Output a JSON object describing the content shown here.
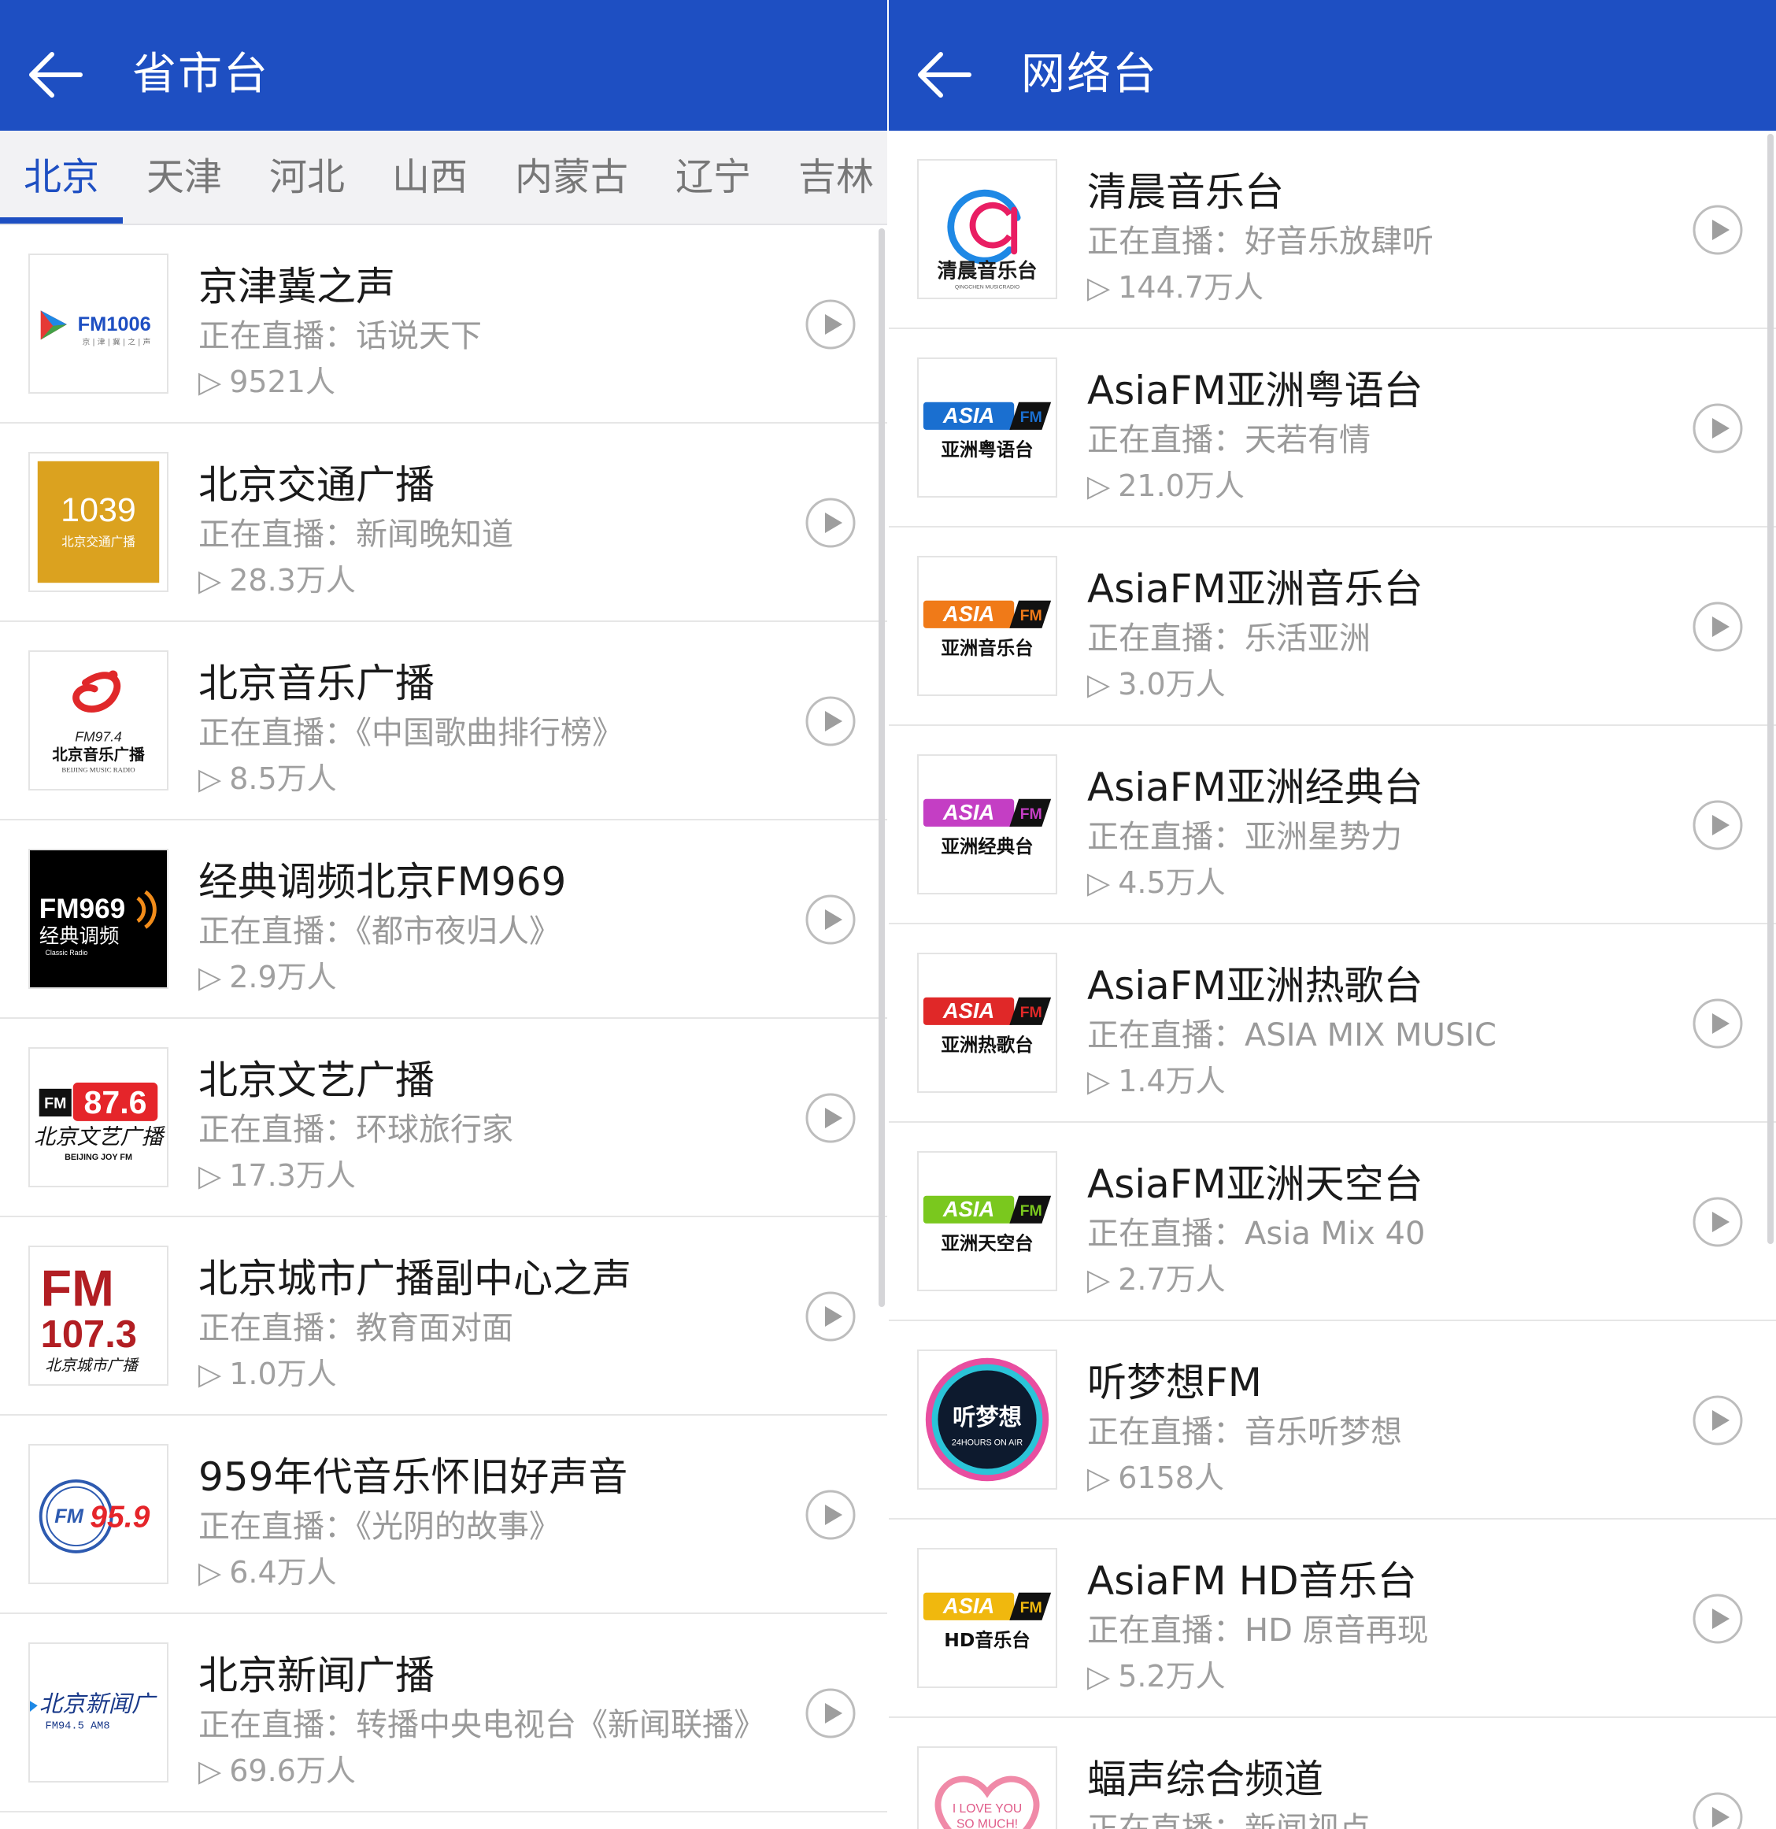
{
  "colors": {
    "accent": "#1e4fc2",
    "text": "#1a1a1a",
    "muted": "#9a9a9a"
  },
  "left": {
    "title": "省市台",
    "tabs": [
      "北京",
      "天津",
      "河北",
      "山西",
      "内蒙古",
      "辽宁",
      "吉林"
    ],
    "active_tab": "北京",
    "stations": [
      {
        "name": "京津冀之声",
        "now_playing": "正在直播：话说天下",
        "listeners": "9521人",
        "logo": "fm1006-logo"
      },
      {
        "name": "北京交通广播",
        "now_playing": "正在直播：新闻晚知道",
        "listeners": "28.3万人",
        "logo": "1039-logo",
        "logo_text": "1039",
        "logo_sub": "北京交通广播"
      },
      {
        "name": "北京音乐广播",
        "now_playing": "正在直播：《中国歌曲排行榜》",
        "listeners": "8.5万人",
        "logo": "fm974-logo",
        "logo_text": "FM97.4",
        "logo_sub": "北京音乐广播",
        "logo_sub2": "BEIJING MUSIC RADIO"
      },
      {
        "name": "经典调频北京FM969",
        "now_playing": "正在直播：《都市夜归人》",
        "listeners": "2.9万人",
        "logo": "fm969-logo",
        "logo_text": "FM969",
        "logo_sub": "经典调频",
        "logo_sub2": "Classic Radio"
      },
      {
        "name": "北京文艺广播",
        "now_playing": "正在直播：环球旅行家",
        "listeners": "17.3万人",
        "logo": "fm876-logo",
        "logo_text": "87.6",
        "logo_sub": "北京文艺广播",
        "logo_sub2": "BEIJING JOY FM"
      },
      {
        "name": "北京城市广播副中心之声",
        "now_playing": "正在直播：教育面对面",
        "listeners": "1.0万人",
        "logo": "fm1073-logo",
        "logo_text": "FM",
        "logo_sub": "107.3",
        "logo_sub2": "北京城市广播"
      },
      {
        "name": "959年代音乐怀旧好声音",
        "now_playing": "正在直播：《光阴的故事》",
        "listeners": "6.4万人",
        "logo": "fm959-logo",
        "logo_text": "95.9"
      },
      {
        "name": "北京新闻广播",
        "now_playing": "正在直播：转播中央电视台《新闻联播》",
        "listeners": "69.6万人",
        "logo": "bj-news-logo",
        "logo_text": "北京新闻广",
        "logo_sub": "FM94.5   AM8"
      }
    ]
  },
  "right": {
    "title": "网络台",
    "stations": [
      {
        "name": "清晨音乐台",
        "now_playing": "正在直播：好音乐放肆听",
        "listeners": "144.7万人",
        "logo": "qingchen-logo",
        "logo_text": "清晨音乐台",
        "logo_sub": "QINGCHEN MUSICRADIO"
      },
      {
        "name": "AsiaFM亚洲粤语台",
        "now_playing": "正在直播：天若有情",
        "listeners": "21.0万人",
        "logo": "asiafm-logo",
        "logo_color": "#1a6fd0",
        "logo_text": "亚洲粤语台"
      },
      {
        "name": "AsiaFM亚洲音乐台",
        "now_playing": "正在直播：乐活亚洲",
        "listeners": "3.0万人",
        "logo": "asiafm-logo",
        "logo_color": "#f07a18",
        "logo_text": "亚洲音乐台"
      },
      {
        "name": "AsiaFM亚洲经典台",
        "now_playing": "正在直播：亚洲星势力",
        "listeners": "4.5万人",
        "logo": "asiafm-logo",
        "logo_color": "#c43ec4",
        "logo_text": "亚洲经典台"
      },
      {
        "name": "AsiaFM亚洲热歌台",
        "now_playing": "正在直播：ASIA MIX MUSIC",
        "listeners": "1.4万人",
        "logo": "asiafm-logo",
        "logo_color": "#e02828",
        "logo_text": "亚洲热歌台"
      },
      {
        "name": "AsiaFM亚洲天空台",
        "now_playing": "正在直播：Asia Mix 40",
        "listeners": "2.7万人",
        "logo": "asiafm-logo",
        "logo_color": "#7ac81e",
        "logo_text": "亚洲天空台"
      },
      {
        "name": "听梦想FM",
        "now_playing": "正在直播：音乐听梦想",
        "listeners": "6158人",
        "logo": "tingmengxiang-logo",
        "logo_text": "听梦想",
        "logo_sub": "24HOURS ON AIR"
      },
      {
        "name": "AsiaFM HD音乐台",
        "now_playing": "正在直播：HD 原音再现",
        "listeners": "5.2万人",
        "logo": "asiafm-logo",
        "logo_color": "#f0b80e",
        "logo_text": "HD音乐台"
      },
      {
        "name": "蝠声综合频道",
        "now_playing": "正在直播：新闻视点",
        "listeners": "",
        "logo": "i-love-you-logo",
        "logo_text": "I LOVE YOU",
        "logo_sub": "SO MUCH!"
      }
    ]
  },
  "icons": {
    "back": "arrow-left-icon",
    "play": "play-circle-icon",
    "listeners": "play-triangle-icon"
  }
}
